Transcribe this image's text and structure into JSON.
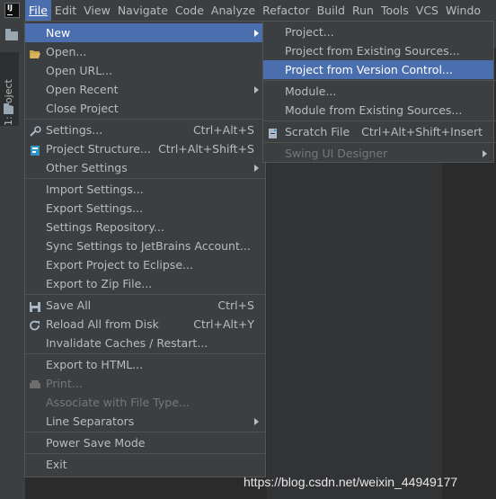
{
  "menubar": {
    "logo": "intellij-logo",
    "items": [
      {
        "label": "File",
        "active": true
      },
      {
        "label": "Edit"
      },
      {
        "label": "View"
      },
      {
        "label": "Navigate"
      },
      {
        "label": "Code"
      },
      {
        "label": "Analyze"
      },
      {
        "label": "Refactor"
      },
      {
        "label": "Build"
      },
      {
        "label": "Run"
      },
      {
        "label": "Tools"
      },
      {
        "label": "VCS"
      },
      {
        "label": "Windo"
      }
    ]
  },
  "tool_window": {
    "project_tab": "1: Project"
  },
  "file_menu": [
    {
      "label": "New",
      "submenu": true,
      "highlighted": true
    },
    {
      "label": "Open...",
      "icon": "folder-open-icon"
    },
    {
      "label": "Open URL..."
    },
    {
      "label": "Open Recent",
      "submenu": true
    },
    {
      "label": "Close Project"
    },
    {
      "separator": true
    },
    {
      "label": "Settings...",
      "shortcut": "Ctrl+Alt+S",
      "icon": "wrench-icon"
    },
    {
      "label": "Project Structure...",
      "shortcut": "Ctrl+Alt+Shift+S",
      "icon": "project-structure-icon"
    },
    {
      "label": "Other Settings",
      "submenu": true
    },
    {
      "separator": true
    },
    {
      "label": "Import Settings..."
    },
    {
      "label": "Export Settings..."
    },
    {
      "label": "Settings Repository..."
    },
    {
      "label": "Sync Settings to JetBrains Account..."
    },
    {
      "label": "Export Project to Eclipse..."
    },
    {
      "label": "Export to Zip File..."
    },
    {
      "separator": true
    },
    {
      "label": "Save All",
      "shortcut": "Ctrl+S",
      "icon": "save-icon"
    },
    {
      "label": "Reload All from Disk",
      "shortcut": "Ctrl+Alt+Y",
      "icon": "reload-icon"
    },
    {
      "label": "Invalidate Caches / Restart..."
    },
    {
      "separator": true
    },
    {
      "label": "Export to HTML..."
    },
    {
      "label": "Print...",
      "disabled": true,
      "icon": "print-icon"
    },
    {
      "label": "Associate with File Type...",
      "disabled": true
    },
    {
      "label": "Line Separators",
      "submenu": true
    },
    {
      "separator": true
    },
    {
      "label": "Power Save Mode"
    },
    {
      "separator": true
    },
    {
      "label": "Exit"
    }
  ],
  "new_submenu": [
    {
      "label": "Project..."
    },
    {
      "label": "Project from Existing Sources..."
    },
    {
      "label": "Project from Version Control...",
      "highlighted": true
    },
    {
      "separator": true
    },
    {
      "label": "Module..."
    },
    {
      "label": "Module from Existing Sources..."
    },
    {
      "separator": true
    },
    {
      "label": "Scratch File",
      "shortcut": "Ctrl+Alt+Shift+Insert",
      "icon": "scratch-file-icon"
    },
    {
      "separator": true
    },
    {
      "label": "Swing UI Designer",
      "submenu": true,
      "disabled": true
    }
  ],
  "watermark": "https://blog.csdn.net/weixin_44949177",
  "colors": {
    "menu_bg": "#3c3f41",
    "highlight": "#4b6eaf",
    "text": "#bbbbbb",
    "disabled": "#777777"
  }
}
